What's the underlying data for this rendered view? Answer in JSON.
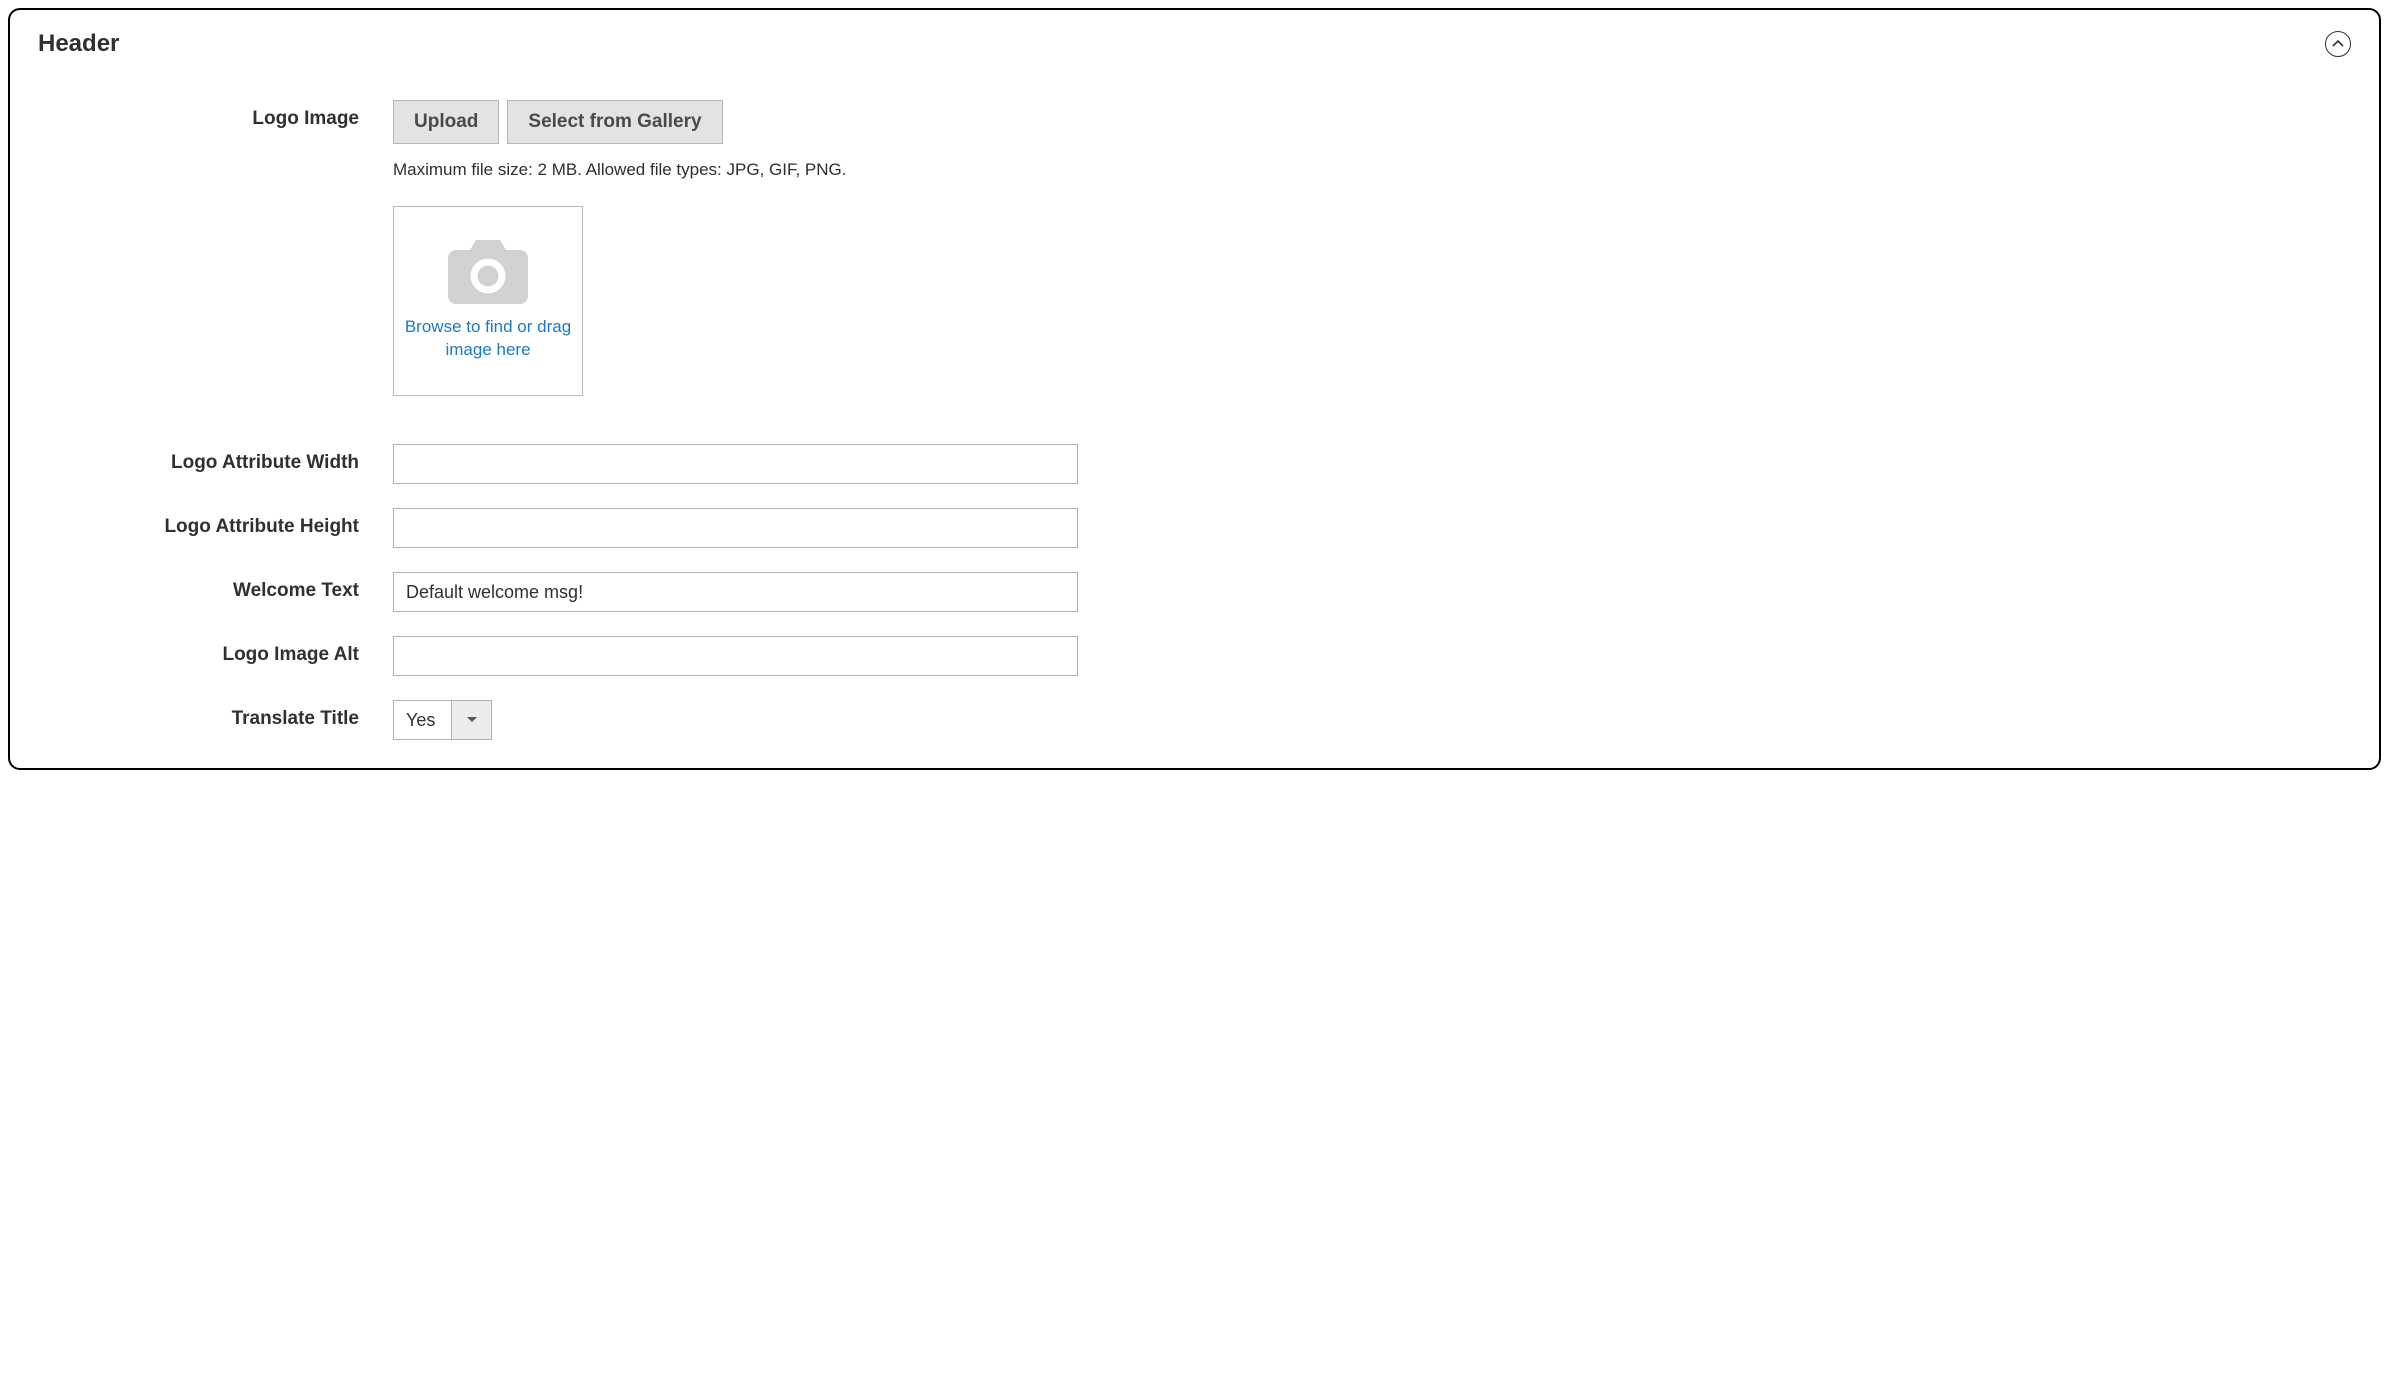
{
  "section": {
    "title": "Header"
  },
  "fields": {
    "logo_image": {
      "label": "Logo Image",
      "upload_btn": "Upload",
      "gallery_btn": "Select from Gallery",
      "help": "Maximum file size: 2 MB. Allowed file types: JPG, GIF, PNG.",
      "dropzone_hint": "Browse to find or drag image here"
    },
    "logo_attr_width": {
      "label": "Logo Attribute Width",
      "value": ""
    },
    "logo_attr_height": {
      "label": "Logo Attribute Height",
      "value": ""
    },
    "welcome_text": {
      "label": "Welcome Text",
      "value": "Default welcome msg!"
    },
    "logo_image_alt": {
      "label": "Logo Image Alt",
      "value": ""
    },
    "translate_title": {
      "label": "Translate Title",
      "value": "Yes"
    }
  }
}
